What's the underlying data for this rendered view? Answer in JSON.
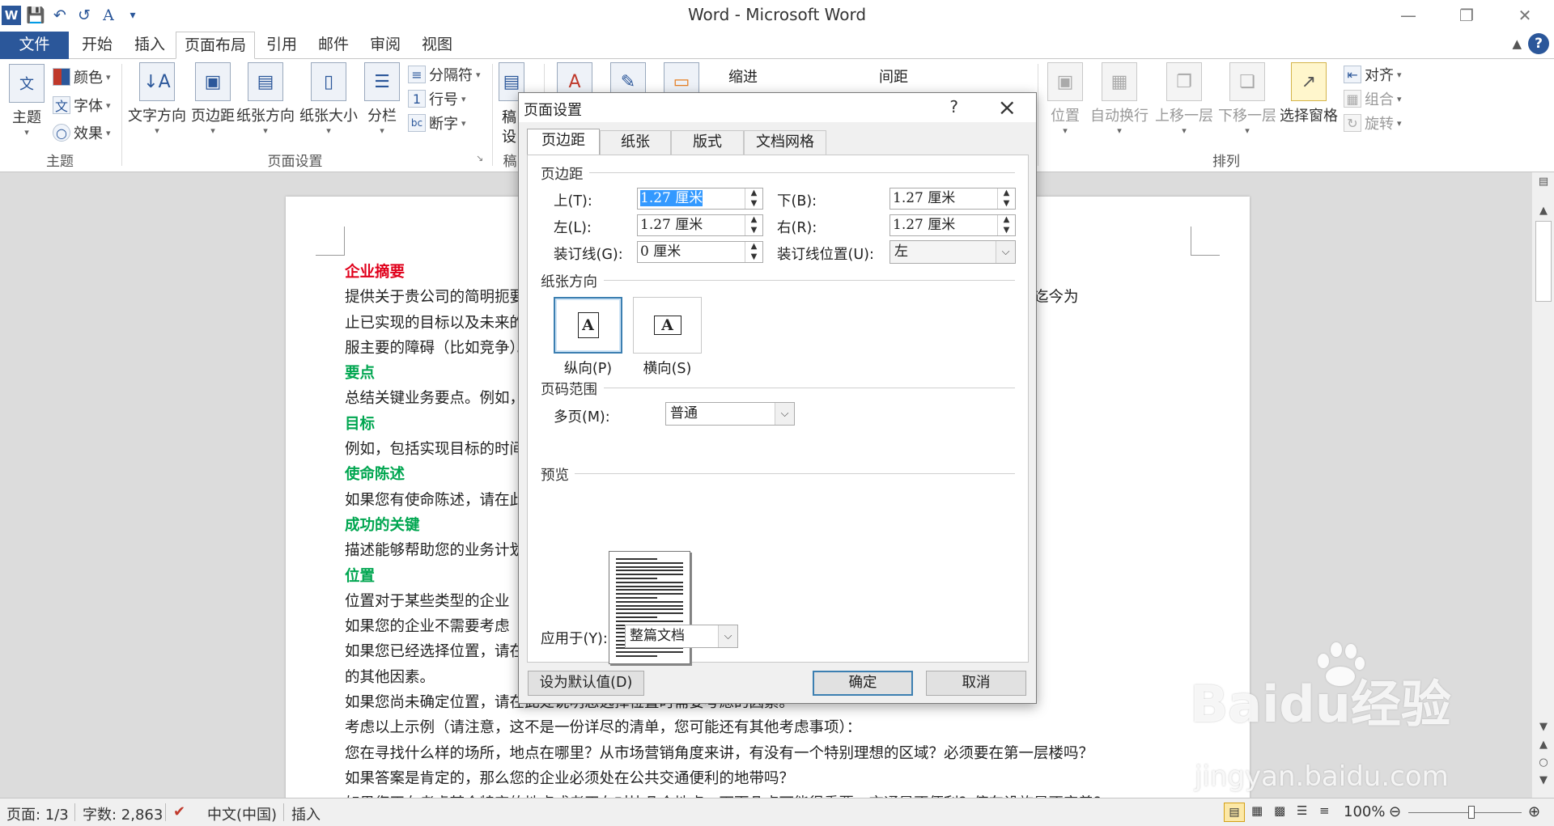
{
  "window": {
    "title": "Word - Microsoft Word"
  },
  "qat": {
    "icons": [
      "word-logo-icon",
      "save-icon",
      "undo-icon",
      "redo-icon",
      "font-color-icon",
      "customize-icon"
    ]
  },
  "tabs": {
    "file": "文件",
    "items": [
      "开始",
      "插入",
      "页面布局",
      "引用",
      "邮件",
      "审阅",
      "视图"
    ],
    "active": "页面布局"
  },
  "ribbon": {
    "theme_group": {
      "label": "主题",
      "themes": "主题",
      "colors": "颜色",
      "fonts": "字体",
      "effects": "效果"
    },
    "page_setup_group": {
      "label": "页面设置",
      "text_direction": "文字方向",
      "margins": "页边距",
      "orientation": "纸张方向",
      "size": "纸张大小",
      "columns": "分栏",
      "breaks": "分隔符",
      "line_numbers": "行号",
      "hyphenation": "断字"
    },
    "manuscript_group": {
      "label": "稿",
      "btn_top": "稿",
      "btn_bottom": "设"
    },
    "paragraph": {
      "indent": "缩进",
      "spacing": "间距"
    },
    "arrange_group": {
      "label": "排列",
      "position": "位置",
      "wrap_text": "自动换行",
      "bring_forward": "上移一层",
      "send_backward": "下移一层",
      "selection_pane": "选择窗格",
      "align": "对齐",
      "group": "组合",
      "rotate": "旋转"
    }
  },
  "document": {
    "lines": [
      {
        "text": "企业摘要",
        "style": "h-red"
      },
      {
        "text": "提供关于贵公司的简明扼要的描述。例如，您可能希望包括企业的性质、企业成立的时间、成立的目的、迄今为",
        "style": ""
      },
      {
        "text": "止已实现的目标以及未来的目标。您也可以包括您的业务计划、实现目标所需的时间以及您将如何克",
        "style": ""
      },
      {
        "text": "服主要的障碍（比如竞争）。",
        "style": ""
      },
      {
        "text": "要点",
        "style": "h-green"
      },
      {
        "text": "总结关键业务要点。例如，",
        "style": ""
      },
      {
        "text": "目标",
        "style": "h-green"
      },
      {
        "text": "例如，包括实现目标的时间",
        "style": ""
      },
      {
        "text": "使命陈述",
        "style": "h-green"
      },
      {
        "text": "如果您有使命陈述，请在此处包括。您也可以包括其他未在企业摘要中提到的有关您的企业的要点。",
        "style": ""
      },
      {
        "text": "成功的关键",
        "style": "h-green"
      },
      {
        "text": "描述能够帮助您的业务计划",
        "style": ""
      },
      {
        "text": "位置",
        "style": "h-green"
      },
      {
        "text": "位置对于某些类型的企业",
        "style": ""
      },
      {
        "text": "如果您的企业不需要考虑",
        "style": ""
      },
      {
        "text": "如果您已经选择位置，请在此处说明其优势和劣势，以及位置对于您的企业来说十分重要",
        "style": ""
      },
      {
        "text": "的其他因素。",
        "style": ""
      },
      {
        "text": "如果您尚未确定位置，请在此处说明您选择位置时需要考虑的因素。",
        "style": ""
      },
      {
        "text": "考虑以上示例（请注意，这不是一份详尽的清单，您可能还有其他考虑事项）：",
        "style": ""
      },
      {
        "text": "您在寻找什么样的场所，地点在哪里？从市场营销角度来讲，有没有一个特别理想的区域？必须要在第一层楼吗？",
        "style": ""
      },
      {
        "text": "如果答案是肯定的，那么您的企业必须处在公共交通便利的地带吗？",
        "style": ""
      },
      {
        "text": "如果您正在考虑某个特定的地点或者正在对比几个地点，下面几点可能很重要：交通是否便利？停车设施是否完善？",
        "style": ""
      }
    ]
  },
  "dialog": {
    "title": "页面设置",
    "help": "?",
    "tabs": [
      "页边距",
      "纸张",
      "版式",
      "文档网格"
    ],
    "active_tab": "页边距",
    "margins_section": "页边距",
    "top_label": "上(T):",
    "top_value": "1.27 厘米",
    "bottom_label": "下(B):",
    "bottom_value": "1.27 厘米",
    "left_label": "左(L):",
    "left_value": "1.27 厘米",
    "right_label": "右(R):",
    "right_value": "1.27 厘米",
    "gutter_label": "装订线(G):",
    "gutter_value": "0 厘米",
    "gutter_pos_label": "装订线位置(U):",
    "gutter_pos_value": "左",
    "orientation_section": "纸张方向",
    "portrait": "纵向(P)",
    "landscape": "横向(S)",
    "orientation_letter": "A",
    "pages_section": "页码范围",
    "multiple_pages_label": "多页(M):",
    "multiple_pages_value": "普通",
    "preview_section": "预览",
    "apply_to_label": "应用于(Y):",
    "apply_to_value": "整篇文档",
    "default_button": "设为默认值(D)",
    "ok_button": "确定",
    "cancel_button": "取消"
  },
  "status": {
    "page": "页面: 1/3",
    "words": "字数: 2,863",
    "language": "中文(中国)",
    "mode": "插入",
    "zoom": "100%"
  },
  "watermark": {
    "logo": "Baidu经验",
    "url": "jingyan.baidu.com"
  }
}
